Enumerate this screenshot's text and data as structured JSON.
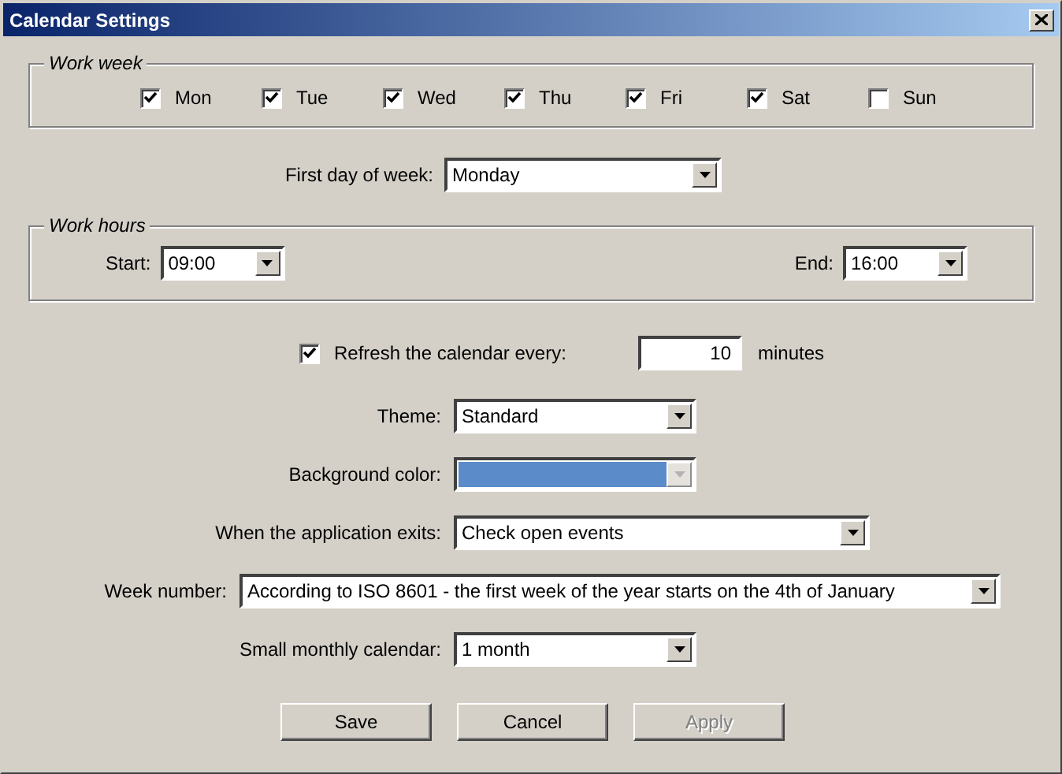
{
  "window": {
    "title": "Calendar Settings"
  },
  "work_week": {
    "legend": "Work week",
    "days": [
      {
        "label": "Mon",
        "checked": true
      },
      {
        "label": "Tue",
        "checked": true
      },
      {
        "label": "Wed",
        "checked": true
      },
      {
        "label": "Thu",
        "checked": true
      },
      {
        "label": "Fri",
        "checked": true
      },
      {
        "label": "Sat",
        "checked": true
      },
      {
        "label": "Sun",
        "checked": false
      }
    ]
  },
  "first_day_of_week": {
    "label": "First day of week:",
    "value": "Monday"
  },
  "work_hours": {
    "legend": "Work hours",
    "start": {
      "label": "Start:",
      "value": "09:00"
    },
    "end": {
      "label": "End:",
      "value": "16:00"
    }
  },
  "refresh": {
    "label": "Refresh the calendar every:",
    "checked": true,
    "value": "10",
    "unit": "minutes"
  },
  "theme": {
    "label": "Theme:",
    "value": "Standard"
  },
  "background_color": {
    "label": "Background color:",
    "color": "#5b8bc9",
    "disabled": true
  },
  "on_exit": {
    "label": "When the application exits:",
    "value": "Check open events"
  },
  "week_number": {
    "label": "Week number:",
    "value": "According to ISO 8601 - the first week of the year starts on the 4th of January"
  },
  "small_monthly_calendar": {
    "label": "Small monthly calendar:",
    "value": "1 month"
  },
  "buttons": [
    {
      "label": "Save",
      "disabled": false
    },
    {
      "label": "Cancel",
      "disabled": false
    },
    {
      "label": "Apply",
      "disabled": true
    }
  ]
}
